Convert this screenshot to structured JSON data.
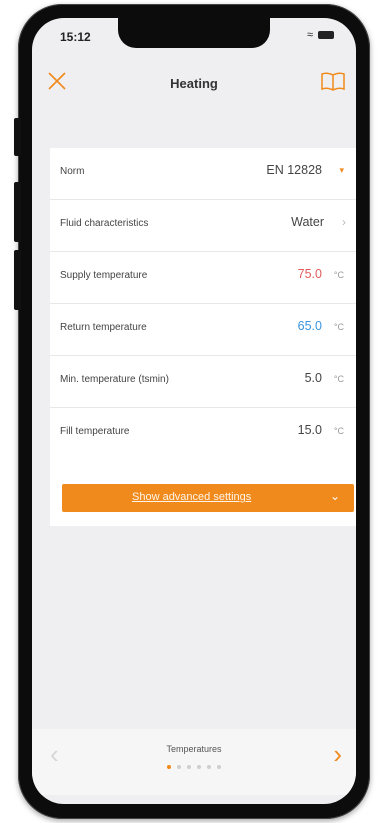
{
  "status_bar": {
    "time": "15:12"
  },
  "nav": {
    "title": "Heating"
  },
  "rows": [
    {
      "label": "Norm",
      "value": "EN 12828"
    },
    {
      "label": "Fluid characteristics",
      "value": "Water"
    },
    {
      "label": "Supply temperature",
      "value": "75.0",
      "unit": "°C",
      "color": "#e45a5a"
    },
    {
      "label": "Return temperature",
      "value": "65.0",
      "unit": "°C",
      "color": "#3a96dd"
    },
    {
      "label": "Min. temperature (tsmin)",
      "value": "5.0",
      "unit": "°C"
    },
    {
      "label": "Fill temperature",
      "value": "15.0",
      "unit": "°C"
    }
  ],
  "advanced_button": {
    "label": "Show advanced settings"
  },
  "footer": {
    "page_label": "Temperatures",
    "page_count": 6,
    "active_page": 1
  },
  "colors": {
    "accent": "#f08a1c",
    "supply": "#e45a5a",
    "return": "#3a96dd"
  },
  "icons": [
    "close-icon",
    "book-icon",
    "chevron-down-icon",
    "chevron-right-icon",
    "arrow-left-icon",
    "arrow-right-icon",
    "wifi-icon",
    "battery-icon"
  ]
}
